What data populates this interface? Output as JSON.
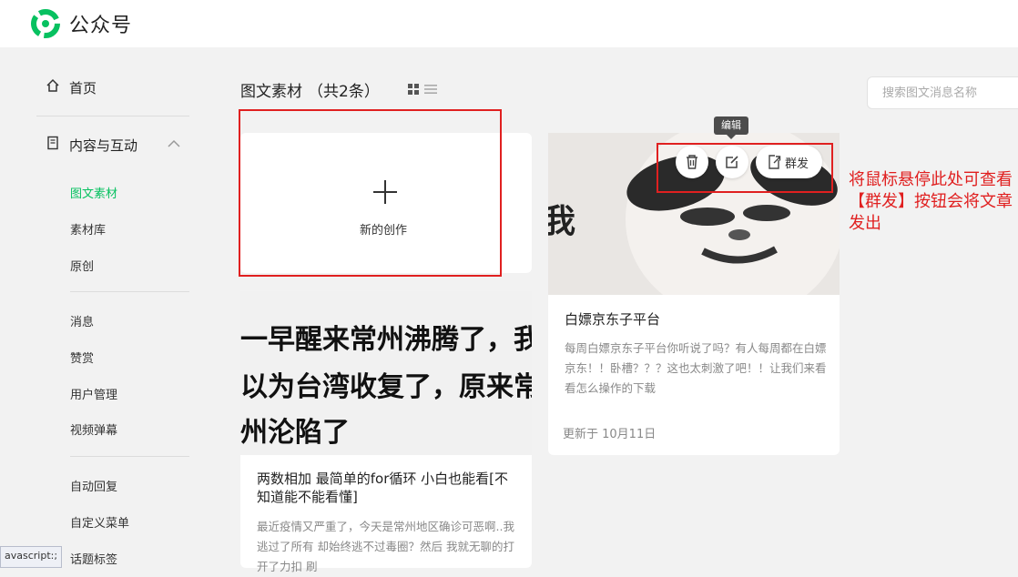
{
  "app": {
    "title": "公众号",
    "brand_color": "#07c160"
  },
  "sidebar": {
    "home": "首页",
    "content_interaction": "内容与互动",
    "sub_items": [
      "图文素材",
      "素材库",
      "原创"
    ],
    "group2": [
      "消息",
      "赞赏",
      "用户管理",
      "视频弹幕"
    ],
    "group3": [
      "自动回复",
      "自定义菜单",
      "话题标签"
    ]
  },
  "main": {
    "title": "图文素材",
    "count": "（共2条）",
    "search_placeholder": "搜索图文消息名称"
  },
  "new_card": {
    "label": "新的创作"
  },
  "article1": {
    "title": "白嫖京东子平台",
    "desc": "每周白嫖京东子平台你听说了吗？有人每周都在白嫖京东！！卧槽？？？这也太刺激了吧！！让我们来看看怎么操作的下载",
    "date": "更新于 10月11日",
    "image_text": "我"
  },
  "hover_actions": {
    "tooltip": "编辑",
    "mass_send": "群发",
    "delete_icon": "trash-icon",
    "edit_icon": "edit-icon",
    "send_icon": "send-icon"
  },
  "article2": {
    "image_lines": [
      "一早醒来常州沸腾了，我",
      "以为台湾收复了，原来常",
      "州沦陷了"
    ],
    "title": "两数相加 最简单的for循环 小白也能看[不知道能不能看懂]",
    "desc": "最近疫情又严重了，今天是常州地区确诊可恶啊..我逃过了所有 却始终逃不过毒圈？然后 我就无聊的打开了力扣 刷"
  },
  "annotation": {
    "line1": "将鼠标悬停此处可查看",
    "line2": "【群发】按钮会将文章发出",
    "color": "#e02020"
  },
  "status": "avascript:;"
}
